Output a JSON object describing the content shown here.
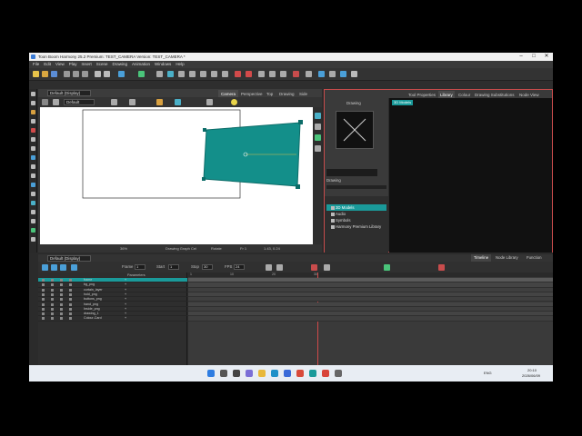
{
  "window": {
    "title": "Toon Boom Harmony 25.2 Premium: TEST_CAMERA Version: TEST_CAMERA *",
    "min_icon": "minimize-icon",
    "max_icon": "maximize-icon",
    "close_icon": "close-icon",
    "min_glyph": "–",
    "max_glyph": "□",
    "close_glyph": "✕"
  },
  "menu": [
    "File",
    "Edit",
    "View",
    "Play",
    "Insert",
    "Scene",
    "Drawing",
    "Animation",
    "Windows",
    "Help"
  ],
  "camera": {
    "tabs": [
      "Camera",
      "Perspective",
      "Top",
      "Drawing",
      "Side"
    ],
    "active_tab": "Camera",
    "view_select": "Default (Display)",
    "preset_select": "Default",
    "status": {
      "zoom": "36%",
      "mode": "Drawing Graph Cel",
      "frame": "Rotate",
      "fps": "Fr 1",
      "coords": "1.43, 0.24"
    },
    "colors": {
      "shape_fill": "#138f8a",
      "accent": "#1a9a9a"
    }
  },
  "library": {
    "tabs": [
      "Tool Properties",
      "Library",
      "Colour",
      "Drawing Substitutions",
      "Node View"
    ],
    "active_tab": "Library",
    "drawing_label": "Drawing",
    "drawing_label2": "Drawing",
    "selected_badge": "3D Models",
    "tree": [
      {
        "label": "3D Models",
        "selected": true
      },
      {
        "label": "Audio",
        "selected": false
      },
      {
        "label": "Symbols",
        "selected": false
      },
      {
        "label": "Harmony Premium Library",
        "selected": false
      }
    ]
  },
  "timeline": {
    "tabs": [
      "Timeline",
      "Node Library",
      "Function"
    ],
    "active_tab": "Timeline",
    "view_select": "Default (Display)",
    "frame_label": "Frame",
    "frame_value": "1",
    "start_label": "Start",
    "start_value": "1",
    "stop_label": "Stop",
    "stop_value": "30",
    "fps_label": "FPS",
    "fps_value": "24",
    "params_label": "Parameters",
    "layers": [
      {
        "name": "frame"
      },
      {
        "name": "bg_png"
      },
      {
        "name": "curtain_layer"
      },
      {
        "name": "hold_png"
      },
      {
        "name": "buttons_png"
      },
      {
        "name": "hand_png"
      },
      {
        "name": "Inside_png"
      },
      {
        "name": "drawing_1"
      },
      {
        "name": "Colour-Card"
      }
    ],
    "ruler_marks": [
      "1",
      "10",
      "20",
      "30"
    ]
  },
  "taskbar": {
    "time": "20:10",
    "date": "2026/06/09",
    "lang": "ENG",
    "icons": [
      "start-icon",
      "search-icon",
      "task-view-icon",
      "chat-icon",
      "explorer-icon",
      "edge-icon",
      "store-icon",
      "chrome-icon",
      "harmony-icon",
      "media-icon",
      "settings-icon"
    ]
  }
}
